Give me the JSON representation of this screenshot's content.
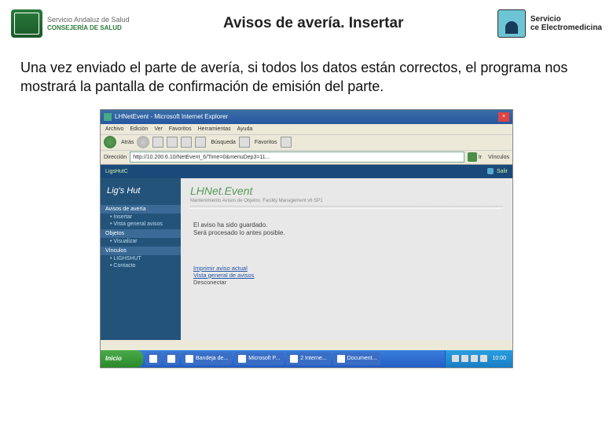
{
  "header": {
    "left_line1": "Servicio Andaluz de Salud",
    "left_line2": "CONSEJERÍA DE SALUD",
    "title": "Avisos de avería. Insertar",
    "right_line1": "Servicio",
    "right_line2": "ce Electromedicina"
  },
  "body_text": "Una vez enviado el parte de avería, si todos los datos están correctos, el programa nos mostrará la pantalla de confirmación de emisión del parte.",
  "ie": {
    "window_title": "LHNetEvent - Microsoft Internet Explorer",
    "menu": [
      "Archivo",
      "Edición",
      "Ver",
      "Favoritos",
      "Herramientas",
      "Ayuda"
    ],
    "toolbar": {
      "back": "Atrás",
      "search": "Búsqueda",
      "favorites": "Favoritos"
    },
    "addr_label": "Dirección",
    "url": "http://10.200.6.10/NetEvent_6/Time=0&menuDep3=11...",
    "go": "Ir",
    "links": "Vínculos"
  },
  "app": {
    "topbar_left": "LigsHutC",
    "topbar_right": "Salir",
    "sidebar": {
      "logo": "Lig's Hut",
      "sections": [
        {
          "title": "Avisos de avería",
          "items": [
            "Insertar",
            "Vista general avisos"
          ]
        },
        {
          "title": "Objetos",
          "items": [
            "Visualizar"
          ]
        },
        {
          "title": "Vínculos",
          "items": [
            "LIGHSHUT",
            "Contacto"
          ]
        }
      ]
    },
    "main": {
      "title": "LHNet.Event",
      "subtitle": "Mantenimiento Avisos de Objetos: Facility Management v6 SP1",
      "msg1": "El aviso ha sido guardado.",
      "msg2": "Será procesado lo antes posible.",
      "link1": "Imprimir aviso actual",
      "link2": "Vista general de avisos",
      "link3": "Desconectar"
    }
  },
  "taskbar": {
    "start": "Inicio",
    "items": [
      "",
      "",
      "Bandeja de...",
      "Microsoft P...",
      "2 Interne...",
      "Document..."
    ],
    "clock": "10:00"
  }
}
